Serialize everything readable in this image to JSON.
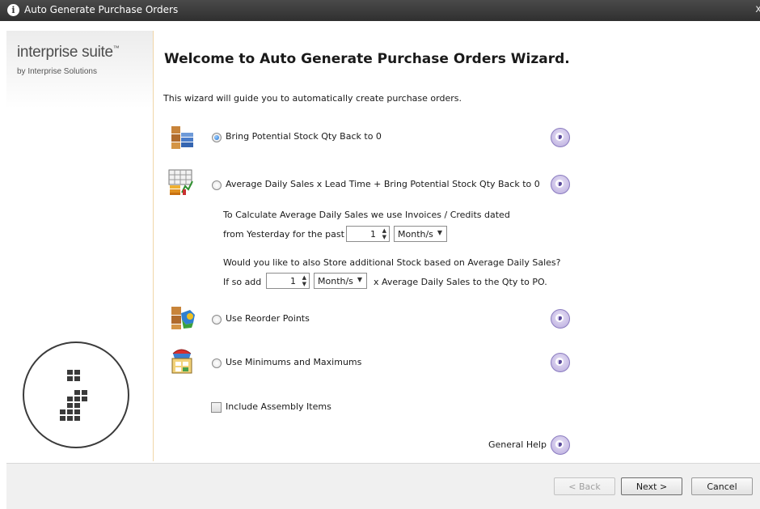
{
  "window": {
    "title": "Auto Generate Purchase Orders",
    "close_glyph": "x"
  },
  "sidebar": {
    "brand": "interprise suite",
    "brand_tm": "™",
    "byline": "by Interprise Solutions"
  },
  "main": {
    "heading": "Welcome to Auto Generate Purchase Orders Wizard.",
    "intro": "This wizard will guide you to automatically create purchase orders."
  },
  "options": [
    {
      "label": "Bring Potential Stock Qty Back to 0",
      "selected": true,
      "icon": "stock-boxes-icon"
    },
    {
      "label": "Average Daily Sales x Lead Time + Bring Potential Stock Qty Back to 0",
      "selected": false,
      "icon": "sales-chart-icon"
    },
    {
      "label": "Use Reorder Points",
      "selected": false,
      "icon": "reorder-points-icon"
    },
    {
      "label": "Use Minimums and Maximums",
      "selected": false,
      "icon": "min-max-icon"
    }
  ],
  "avg_sales": {
    "line1": "To Calculate Average Daily Sales we use Invoices / Credits dated",
    "line2_prefix": "from Yesterday for the past",
    "period_value": "1",
    "period_unit": "Month/s",
    "line3": "Would you like to also Store additional Stock based on Average Daily Sales?",
    "line4_prefix": "If so add",
    "store_value": "1",
    "store_unit": "Month/s",
    "line4_suffix": "x Average Daily Sales to the Qty to PO."
  },
  "include_assembly": {
    "label": "Include Assembly Items",
    "checked": false
  },
  "general_help": "General Help",
  "buttons": {
    "back": "< Back",
    "next": "Next >",
    "cancel": "Cancel"
  },
  "colors": {
    "titlebar": "#3a3a3a",
    "help_accent": "#8b7cc0",
    "radio_selected": "#1f6fd0"
  }
}
